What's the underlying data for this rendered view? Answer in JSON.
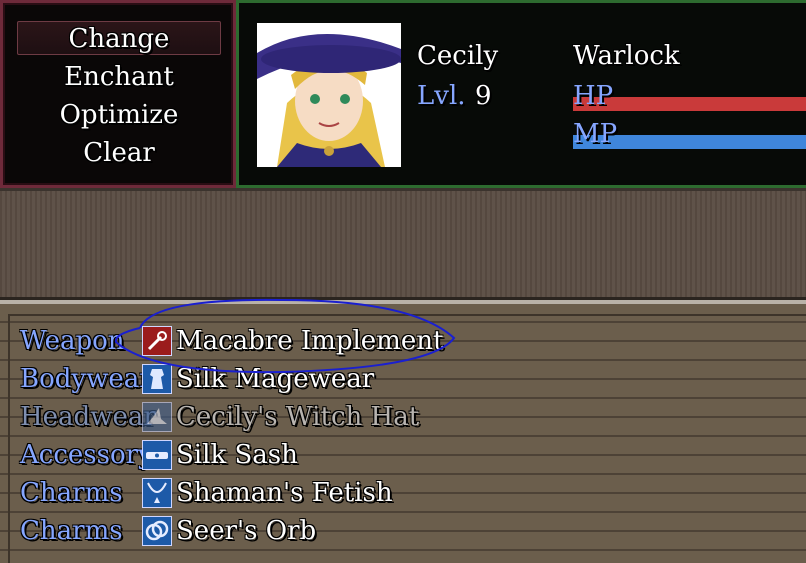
{
  "command_window": {
    "commands": [
      {
        "label": "Change",
        "selected": true
      },
      {
        "label": "Enchant",
        "selected": false
      },
      {
        "label": "Optimize",
        "selected": false
      },
      {
        "label": "Clear",
        "selected": false
      }
    ]
  },
  "status": {
    "name": "Cecily",
    "class": "Warlock",
    "level_label": "Lvl.",
    "level_value": "9",
    "hp_label": "HP",
    "mp_label": "MP",
    "hp_fill": 1.0,
    "mp_fill": 1.0,
    "hp_color": "#c93a3a",
    "mp_color": "#3f86db"
  },
  "help": {
    "text": ""
  },
  "equipment": {
    "slots": [
      {
        "slot": "Weapon",
        "item": "Macabre Implement",
        "icon": "staff-icon",
        "dim": false
      },
      {
        "slot": "Bodywear",
        "item": "Silk Magewear",
        "icon": "robe-icon",
        "dim": false
      },
      {
        "slot": "Headwear",
        "item": "Cecily's Witch Hat",
        "icon": "witch-hat-icon",
        "dim": true
      },
      {
        "slot": "Accessory",
        "item": "Silk Sash",
        "icon": "sash-icon",
        "dim": false
      },
      {
        "slot": "Charms",
        "item": "Shaman's Fetish",
        "icon": "necklace-icon",
        "dim": false
      },
      {
        "slot": "Charms",
        "item": "Seer's Orb",
        "icon": "orb-ring-icon",
        "dim": false
      }
    ]
  },
  "colors": {
    "label_blue": "#86a6ff",
    "command_border": "#6e2a3a",
    "status_border": "#2d6b2f"
  }
}
